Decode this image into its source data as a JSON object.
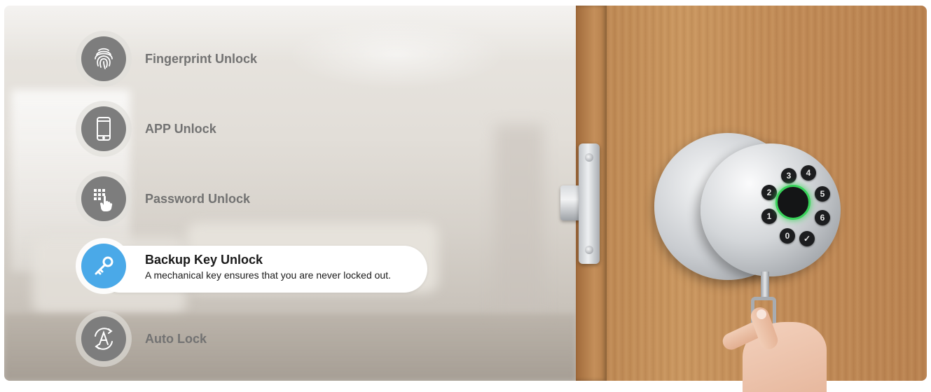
{
  "features": [
    {
      "label": "Fingerprint Unlock",
      "icon": "fingerprint-icon",
      "active": false
    },
    {
      "label": "APP Unlock",
      "icon": "smartphone-icon",
      "active": false
    },
    {
      "label": "Password Unlock",
      "icon": "keypad-touch-icon",
      "active": false
    },
    {
      "label": "Backup Key Unlock",
      "icon": "key-icon",
      "active": true,
      "description": "A mechanical key ensures that you are never locked out."
    },
    {
      "label": "Auto Lock",
      "icon": "auto-lock-icon",
      "active": false
    }
  ],
  "keypad": {
    "keys": [
      "3",
      "4",
      "2",
      "5",
      "1",
      "6",
      "0",
      "✓"
    ],
    "sensor_color": "#39d35a"
  },
  "colors": {
    "icon_gray": "#7d7d7d",
    "icon_active": "#4aa9e8",
    "label_inactive": "#727272",
    "label_active": "#1a1a1a"
  }
}
